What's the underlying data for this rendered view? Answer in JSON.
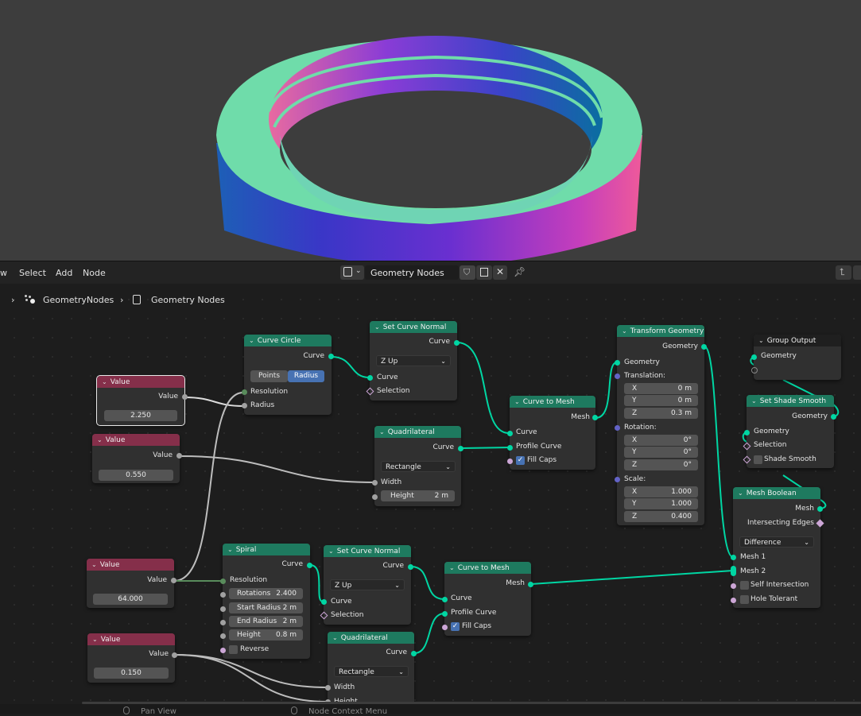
{
  "menu": {
    "view": "w",
    "select": "Select",
    "add": "Add",
    "node": "Node"
  },
  "tree": {
    "name": "Geometry Nodes"
  },
  "breadcrumb": {
    "object": "GeometryNodes",
    "tree": "Geometry Nodes"
  },
  "nodes": {
    "value1": {
      "title": "Value",
      "out": "Value",
      "val": "2.250"
    },
    "value2": {
      "title": "Value",
      "out": "Value",
      "val": "0.550"
    },
    "value3": {
      "title": "Value",
      "out": "Value",
      "val": "64.000"
    },
    "value4": {
      "title": "Value",
      "out": "Value",
      "val": "0.150"
    },
    "curve_circle": {
      "title": "Curve Circle",
      "out": "Curve",
      "mode_points": "Points",
      "mode_radius": "Radius",
      "in_resolution": "Resolution",
      "in_radius": "Radius"
    },
    "scn1": {
      "title": "Set Curve Normal",
      "out": "Curve",
      "mode": "Z Up",
      "in_curve": "Curve",
      "in_selection": "Selection"
    },
    "quad1": {
      "title": "Quadrilateral",
      "out": "Curve",
      "mode": "Rectangle",
      "in_width": "Width",
      "in_height": "Height",
      "height_val": "2 m"
    },
    "ctm1": {
      "title": "Curve to Mesh",
      "out": "Mesh",
      "in_curve": "Curve",
      "in_profile": "Profile Curve",
      "fill_caps": "Fill Caps"
    },
    "transform": {
      "title": "Transform Geometry",
      "out": "Geometry",
      "in_geo": "Geometry",
      "translation": "Translation:",
      "rotation": "Rotation:",
      "scale": "Scale:",
      "t": [
        {
          "axis": "X",
          "v": "0 m"
        },
        {
          "axis": "Y",
          "v": "0 m"
        },
        {
          "axis": "Z",
          "v": "0.3 m"
        }
      ],
      "r": [
        {
          "axis": "X",
          "v": "0°"
        },
        {
          "axis": "Y",
          "v": "0°"
        },
        {
          "axis": "Z",
          "v": "0°"
        }
      ],
      "s": [
        {
          "axis": "X",
          "v": "1.000"
        },
        {
          "axis": "Y",
          "v": "1.000"
        },
        {
          "axis": "Z",
          "v": "0.400"
        }
      ]
    },
    "group_output": {
      "title": "Group Output",
      "in_geo": "Geometry"
    },
    "shade_smooth": {
      "title": "Set Shade Smooth",
      "out": "Geometry",
      "in_geo": "Geometry",
      "in_selection": "Selection",
      "shade_smooth": "Shade Smooth"
    },
    "boolean": {
      "title": "Mesh Boolean",
      "out_mesh": "Mesh",
      "out_edges": "Intersecting Edges",
      "mode": "Difference",
      "in_mesh1": "Mesh 1",
      "in_mesh2": "Mesh 2",
      "self_intersection": "Self Intersection",
      "hole_tolerant": "Hole Tolerant"
    },
    "spiral": {
      "title": "Spiral",
      "out": "Curve",
      "in_resolution": "Resolution",
      "rotations_lbl": "Rotations",
      "rotations": "2.400",
      "start_radius_lbl": "Start Radius",
      "start_radius": "2 m",
      "end_radius_lbl": "End Radius",
      "end_radius": "2 m",
      "height_lbl": "Height",
      "height": "0.8 m",
      "reverse": "Reverse"
    },
    "scn2": {
      "title": "Set Curve Normal",
      "out": "Curve",
      "mode": "Z Up",
      "in_curve": "Curve",
      "in_selection": "Selection"
    },
    "ctm2": {
      "title": "Curve to Mesh",
      "out": "Mesh",
      "in_curve": "Curve",
      "in_profile": "Profile Curve",
      "fill_caps": "Fill Caps"
    },
    "quad2": {
      "title": "Quadrilateral",
      "out": "Curve",
      "mode": "Rectangle",
      "in_width": "Width",
      "in_height": "Height"
    }
  },
  "status": {
    "pan": "Pan View",
    "context": "Node Context Menu"
  },
  "colors": {
    "geometry_link": "#00d6a3",
    "float_link": "#c8c8c8",
    "int_link": "#598c5c",
    "header_green": "#1e7a5f",
    "header_value": "#852f4a",
    "accent_blue": "#4772b3"
  }
}
